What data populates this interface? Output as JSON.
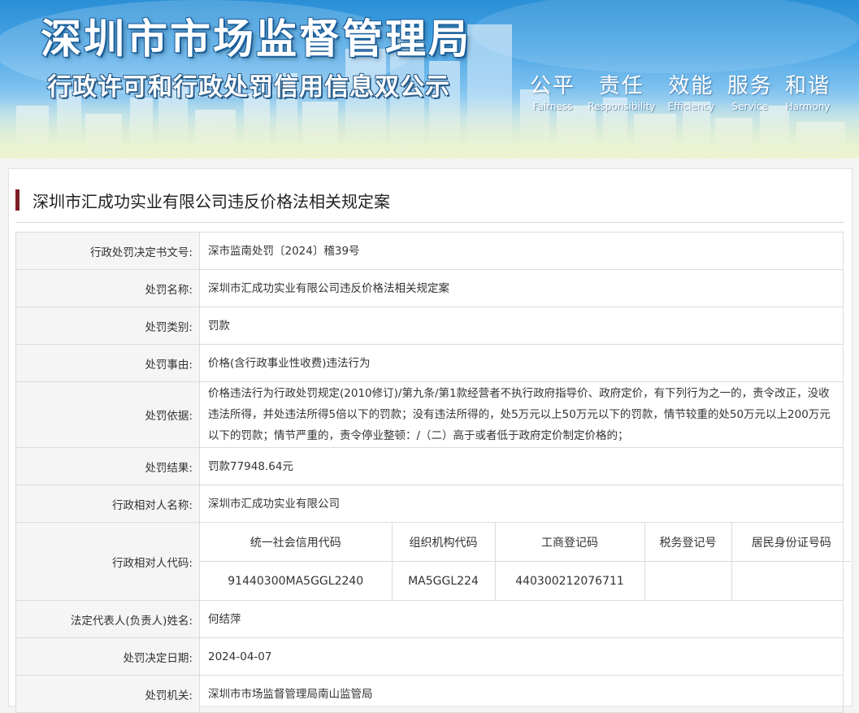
{
  "banner": {
    "title": "深圳市市场监督管理局",
    "subtitle": "行政许可和行政处罚信用信息双公示",
    "slogans": [
      {
        "cn": "公平",
        "en": "Fairness"
      },
      {
        "cn": "责任",
        "en": "Responsibility"
      },
      {
        "cn": "效能",
        "en": "Efficiency"
      },
      {
        "cn": "服务",
        "en": "Service"
      },
      {
        "cn": "和谐",
        "en": "Harmony"
      }
    ]
  },
  "case": {
    "title": "深圳市汇成功实业有限公司违反价格法相关规定案",
    "accent_color": "#7e1f23"
  },
  "fields": {
    "decision_no": {
      "label": "行政处罚决定书文号:",
      "value": "深市监南处罚〔2024〕稽39号"
    },
    "penalty_name": {
      "label": "处罚名称:",
      "value": "深圳市汇成功实业有限公司违反价格法相关规定案"
    },
    "penalty_type": {
      "label": "处罚类别:",
      "value": "罚款"
    },
    "penalty_reason": {
      "label": "处罚事由:",
      "value": "价格(含行政事业性收费)违法行为"
    },
    "penalty_basis": {
      "label": "处罚依据:",
      "value": "价格违法行为行政处罚规定(2010修订)/第九条/第1款经营者不执行政府指导价、政府定价，有下列行为之一的，责令改正，没收违法所得，并处违法所得5倍以下的罚款；没有违法所得的，处5万元以上50万元以下的罚款，情节较重的处50万元以上200万元以下的罚款；情节严重的，责令停业整顿：/（二）高于或者低于政府定价制定价格的；"
    },
    "penalty_result": {
      "label": "处罚结果:",
      "value": "罚款77948.64元"
    },
    "party_name": {
      "label": "行政相对人名称:",
      "value": "深圳市汇成功实业有限公司"
    },
    "party_codes": {
      "label": "行政相对人代码:",
      "headers": [
        "统一社会信用代码",
        "组织机构代码",
        "工商登记码",
        "税务登记号",
        "居民身份证号码"
      ],
      "values": [
        "91440300MA5GGL2240",
        "MA5GGL224",
        "440300212076711",
        "",
        ""
      ]
    },
    "legal_rep": {
      "label": "法定代表人(负责人)姓名:",
      "value": "何结萍"
    },
    "decision_date": {
      "label": "处罚决定日期:",
      "value": "2024-04-07"
    },
    "authority": {
      "label": "处罚机关:",
      "value": "深圳市市场监督管理局南山监管局"
    }
  }
}
